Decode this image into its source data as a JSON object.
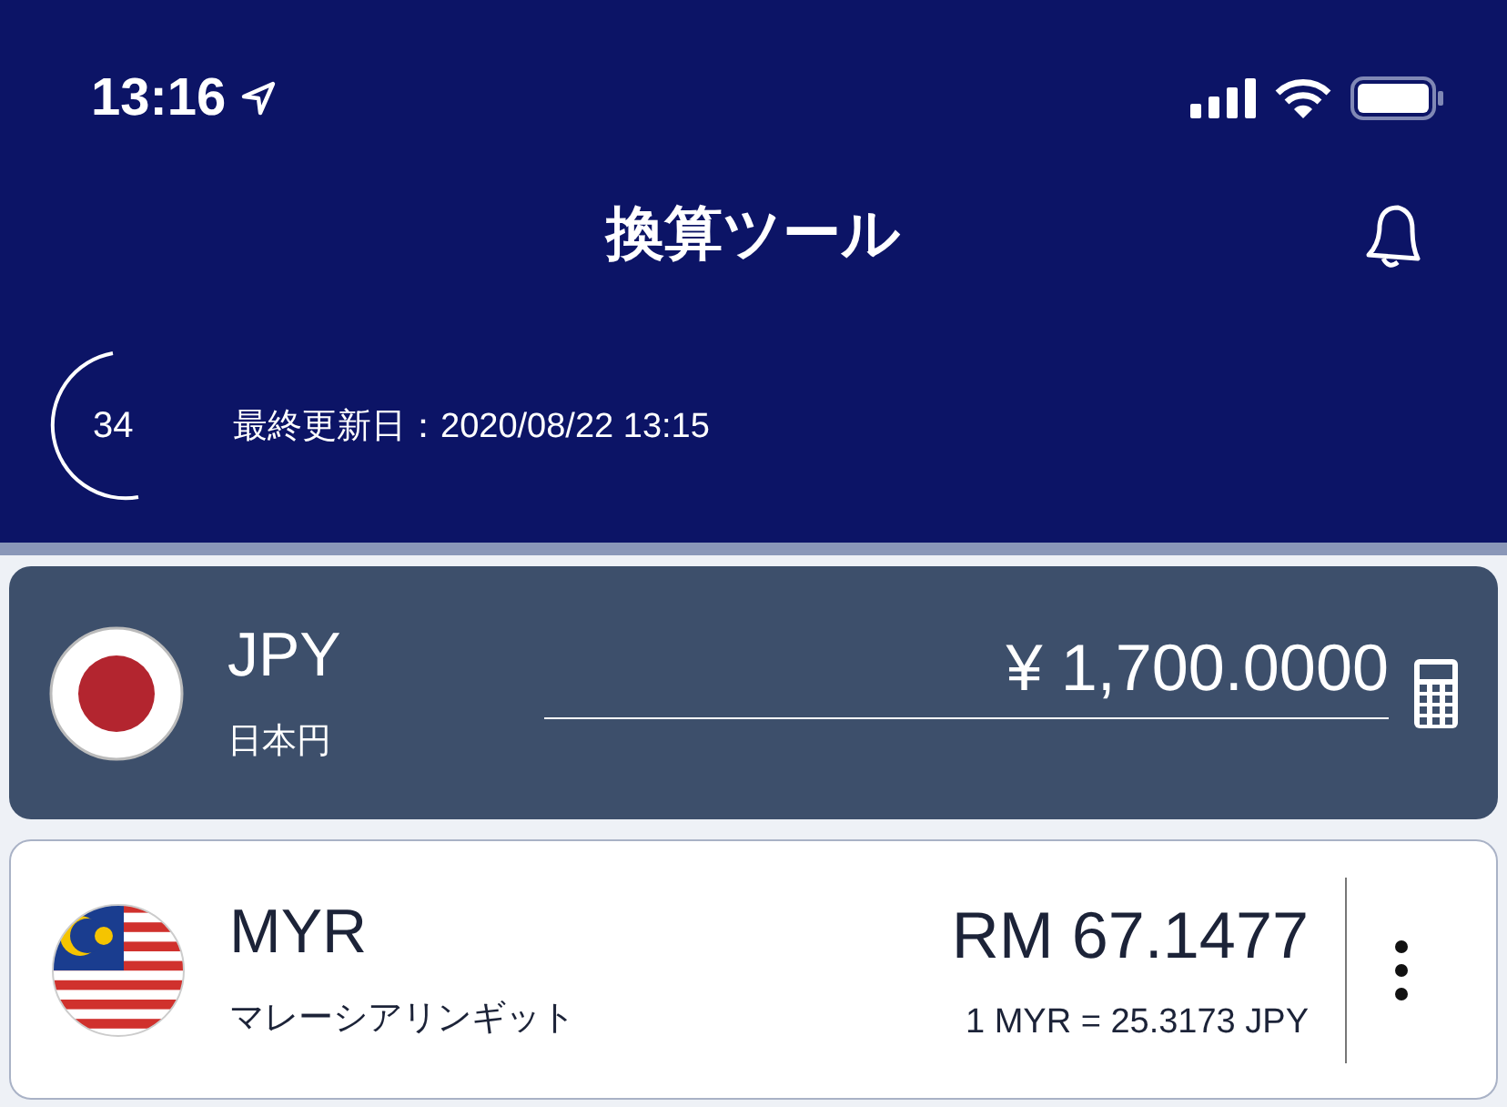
{
  "status_bar": {
    "time": "13:16"
  },
  "header": {
    "title": "換算ツール"
  },
  "update": {
    "countdown": "34",
    "label": "最終更新日：2020/08/22 13:15"
  },
  "base_currency": {
    "code": "JPY",
    "name": "日本円",
    "amount": "¥ 1,700.0000"
  },
  "currencies": [
    {
      "code": "MYR",
      "name": "マレーシアリンギット",
      "amount": "RM 67.1477",
      "rate": "1 MYR = 25.3173 JPY"
    }
  ]
}
